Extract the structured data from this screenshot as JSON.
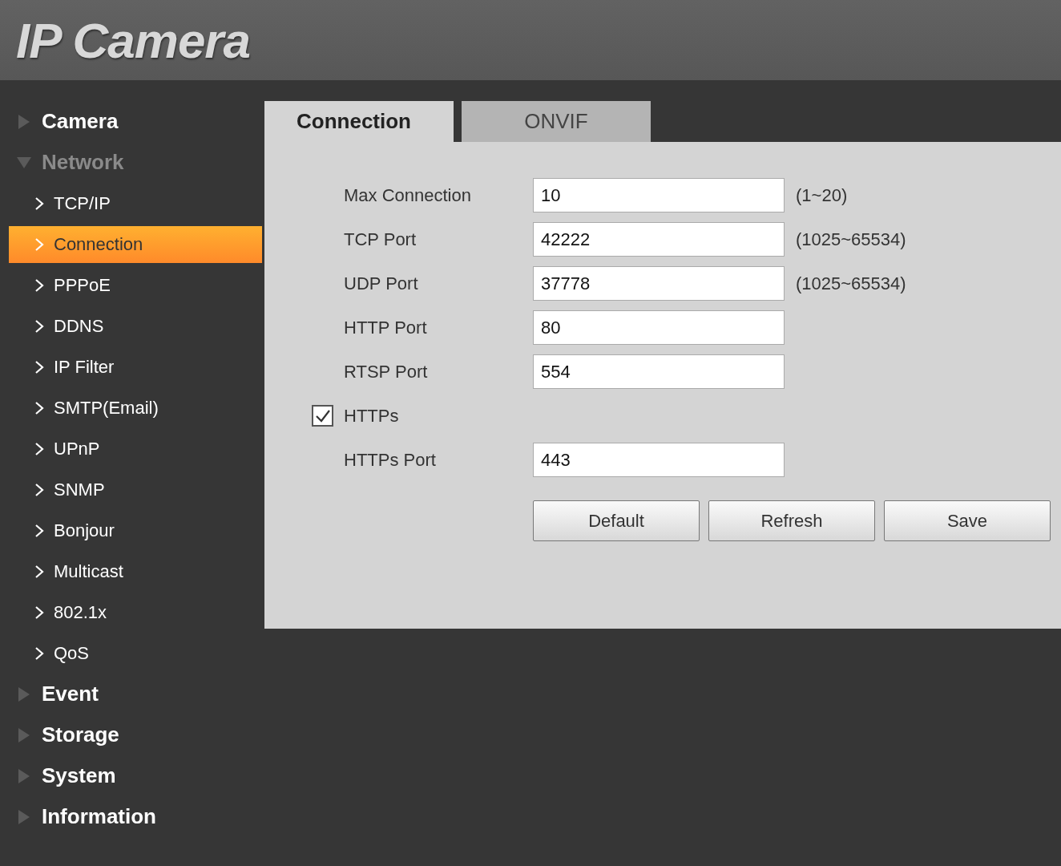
{
  "header": {
    "logo": "IP Camera"
  },
  "menu": [
    {
      "label": "Camera",
      "expanded": false
    },
    {
      "label": "Network",
      "expanded": true,
      "children": [
        {
          "label": "TCP/IP",
          "selected": false
        },
        {
          "label": "Connection",
          "selected": true
        },
        {
          "label": "PPPoE",
          "selected": false
        },
        {
          "label": "DDNS",
          "selected": false
        },
        {
          "label": "IP Filter",
          "selected": false
        },
        {
          "label": "SMTP(Email)",
          "selected": false
        },
        {
          "label": "UPnP",
          "selected": false
        },
        {
          "label": "SNMP",
          "selected": false
        },
        {
          "label": "Bonjour",
          "selected": false
        },
        {
          "label": "Multicast",
          "selected": false
        },
        {
          "label": "802.1x",
          "selected": false
        },
        {
          "label": "QoS",
          "selected": false
        }
      ]
    },
    {
      "label": "Event",
      "expanded": false
    },
    {
      "label": "Storage",
      "expanded": false
    },
    {
      "label": "System",
      "expanded": false
    },
    {
      "label": "Information",
      "expanded": false
    }
  ],
  "tabs": [
    {
      "label": "Connection",
      "selected": true
    },
    {
      "label": "ONVIF",
      "selected": false
    }
  ],
  "form": [
    {
      "kind": "field",
      "label": "Max Connection",
      "value": "10",
      "hint": "(1~20)"
    },
    {
      "kind": "field",
      "label": "TCP Port",
      "value": "42222",
      "hint": "(1025~65534)"
    },
    {
      "kind": "field",
      "label": "UDP Port",
      "value": "37778",
      "hint": "(1025~65534)"
    },
    {
      "kind": "field",
      "label": "HTTP Port",
      "value": "80"
    },
    {
      "kind": "field",
      "label": "RTSP Port",
      "value": "554"
    },
    {
      "kind": "checkbox",
      "label": "HTTPs",
      "checked": true
    },
    {
      "kind": "field",
      "label": "HTTPs Port",
      "value": "443"
    }
  ],
  "buttons": [
    "Default",
    "Refresh",
    "Save"
  ]
}
